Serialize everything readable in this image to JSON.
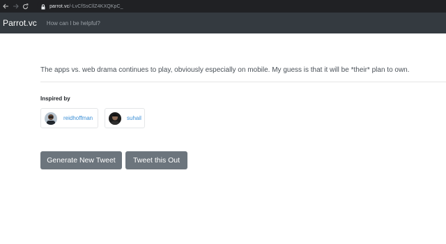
{
  "browser": {
    "url_host": "parrot.vc",
    "url_path": "/-LvCfSsCllZ4KXQKpC_",
    "icons": [
      "back-arrow-icon",
      "forward-arrow-icon",
      "reload-icon",
      "lock-icon"
    ]
  },
  "navbar": {
    "brand": "Parrot.vc",
    "prompt": "How can I be helpful?"
  },
  "main": {
    "tweet_text": "The apps vs. web drama continues to play, obviously especially on mobile. My guess is that it will be *their* plan to own.",
    "inspired_by_heading": "Inspired by",
    "inspired_by": [
      {
        "name": "reidhoffman"
      },
      {
        "name": "suhail"
      }
    ],
    "buttons": {
      "generate_label": "Generate New Tweet",
      "tweet_label": "Tweet this Out"
    }
  },
  "colors": {
    "navbar_bg": "#343a40",
    "button_bg": "#6c757d",
    "link": "#3b8fd6"
  }
}
